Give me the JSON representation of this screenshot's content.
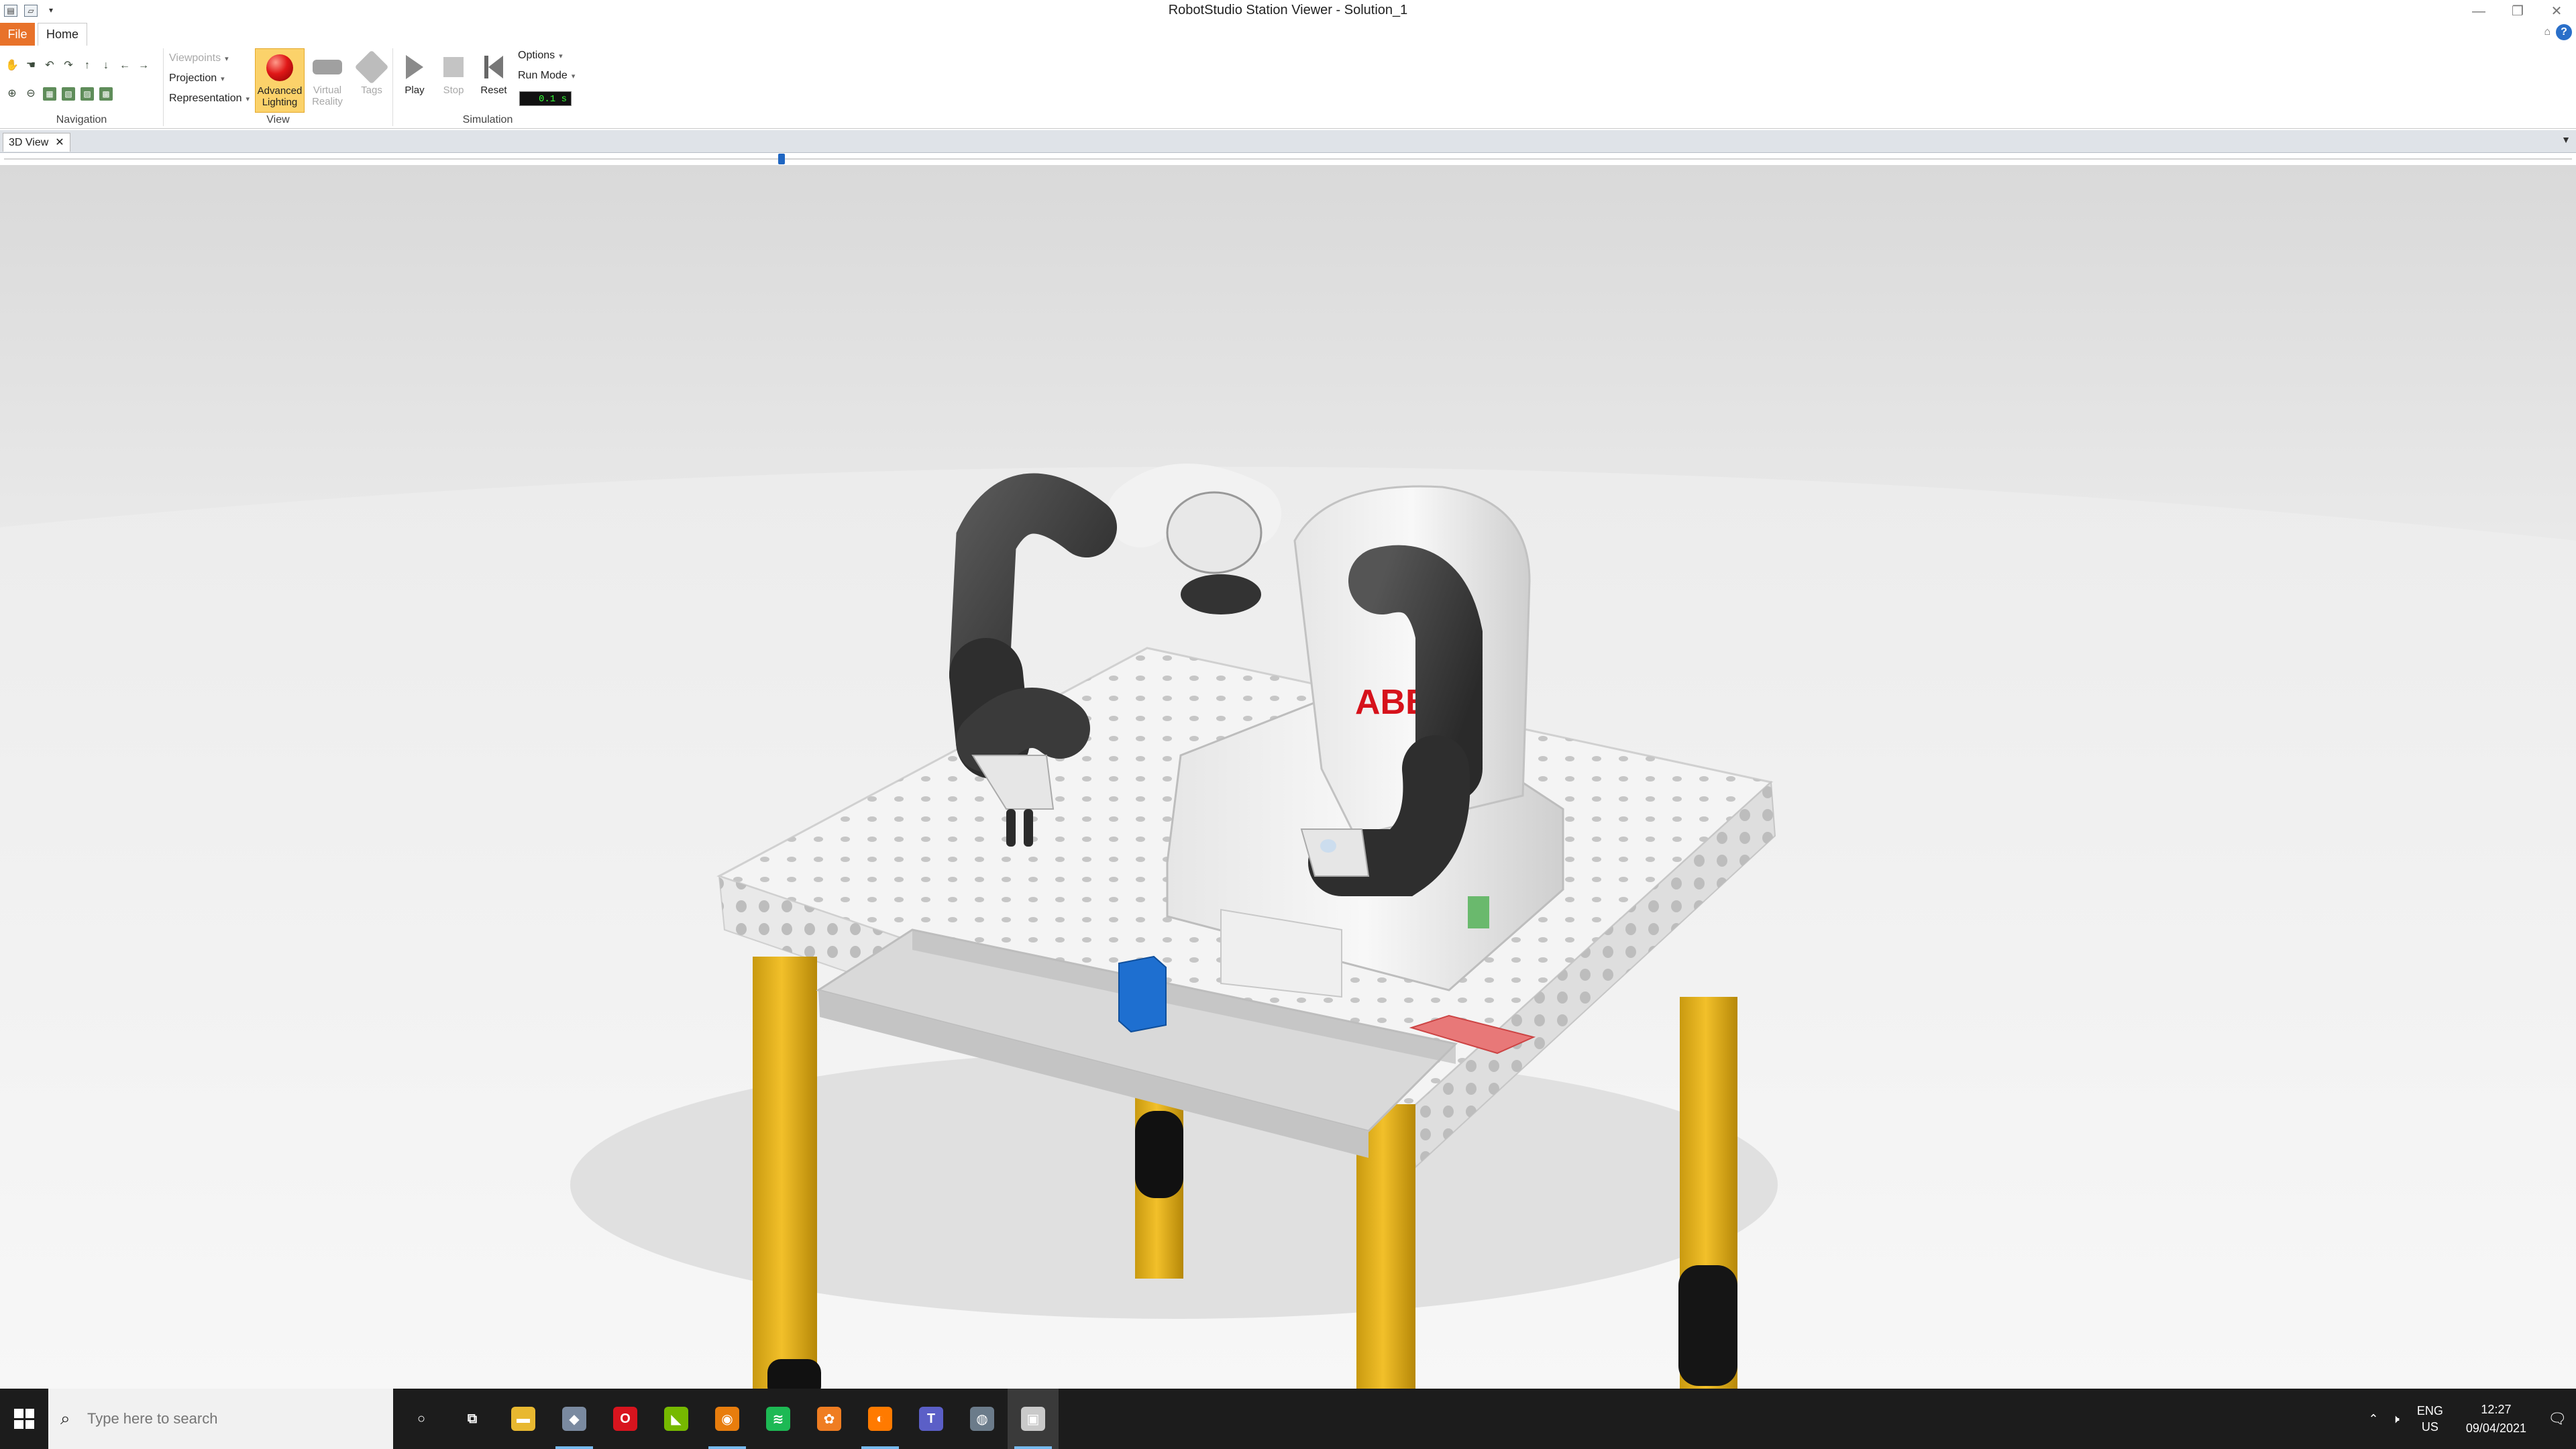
{
  "window": {
    "title": "RobotStudio Station Viewer - Solution_1",
    "controls": [
      "—",
      "❐",
      "✕"
    ]
  },
  "ribbon": {
    "tabs": {
      "file": "File",
      "home": "Home"
    },
    "navigation": {
      "label": "Navigation"
    },
    "view": {
      "label": "View",
      "viewpoints": "Viewpoints",
      "projection": "Projection",
      "representation": "Representation",
      "advanced_lighting": "Advanced Lighting",
      "virtual_reality": "Virtual Reality",
      "tags": "Tags"
    },
    "simulation": {
      "label": "Simulation",
      "play": "Play",
      "stop": "Stop",
      "reset": "Reset",
      "options": "Options",
      "run_mode": "Run Mode",
      "time": "0.1 s"
    }
  },
  "document": {
    "tab_label": "3D View",
    "close": "✕"
  },
  "scene": {
    "robot_brand": "ABB"
  },
  "taskbar": {
    "search_placeholder": "Type here to search",
    "language": "ENG",
    "region": "US",
    "time": "12:27",
    "date": "09/04/2021",
    "apps": [
      {
        "name": "cortana-icon",
        "glyph": "○",
        "color": "transparent"
      },
      {
        "name": "task-view-icon",
        "glyph": "⧉",
        "color": "transparent"
      },
      {
        "name": "file-explorer-icon",
        "glyph": "▬",
        "color": "#e8b830"
      },
      {
        "name": "app-icon-5",
        "glyph": "◆",
        "color": "#7a8aa0"
      },
      {
        "name": "opera-icon",
        "glyph": "O",
        "color": "#d8141e"
      },
      {
        "name": "nvidia-icon",
        "glyph": "◣",
        "color": "#76b900"
      },
      {
        "name": "blender-icon",
        "glyph": "◉",
        "color": "#e87d0d"
      },
      {
        "name": "spotify-icon",
        "glyph": "≋",
        "color": "#1db954"
      },
      {
        "name": "app-icon-9",
        "glyph": "✿",
        "color": "#ef7d22"
      },
      {
        "name": "app-icon-10",
        "glyph": "◐",
        "color": "#ff7a00"
      },
      {
        "name": "teams-icon",
        "glyph": "T",
        "color": "#5b5fc7"
      },
      {
        "name": "app-icon-12",
        "glyph": "◍",
        "color": "#6b7b8a"
      },
      {
        "name": "robotstudio-icon",
        "glyph": "▣",
        "color": "#c9c9c9"
      }
    ]
  }
}
